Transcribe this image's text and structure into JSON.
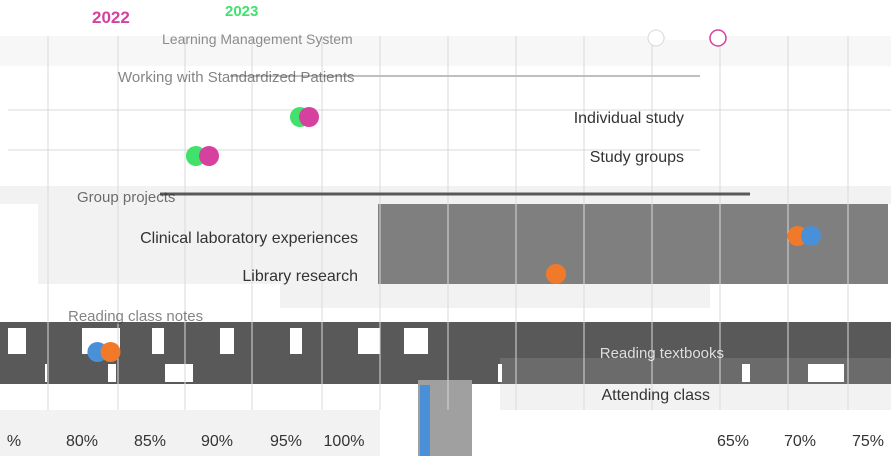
{
  "chart_data": {
    "type": "scatter",
    "legend": {
      "placement": "top-left",
      "entries": [
        {
          "name": "2022",
          "color": "#d6409f"
        },
        {
          "name": "2023",
          "color": "#41e26b"
        }
      ]
    },
    "colors": {
      "2022": "#d6409f",
      "2023": "#41e26b",
      "orange": "#f07a2a",
      "blue": "#4a90d9",
      "gray_block": "#595959",
      "light_block": "#f2f2f2",
      "mid_gray": "#7f7f7f"
    },
    "categories": [
      "Learning Management System",
      "Working with Standardized Patients",
      "Individual study",
      "Study groups",
      "Group projects",
      "Clinical laboratory experiences",
      "Library research",
      "Reading class notes",
      "Reading textbooks",
      "Attending class"
    ],
    "series_points": [
      {
        "category": "Individual study",
        "color": "#41e26b",
        "x": 0.55
      },
      {
        "category": "Individual study",
        "color": "#d6409f",
        "x": 0.56
      },
      {
        "category": "Study groups",
        "color": "#41e26b",
        "x": 0.89
      },
      {
        "category": "Study groups",
        "color": "#d6409f",
        "x": 0.9
      },
      {
        "category": "Clinical laboratory experiences",
        "color": "#f07a2a",
        "x": 0.68
      },
      {
        "category": "Clinical laboratory experiences",
        "color": "#4a90d9",
        "x": 0.69
      },
      {
        "category": "Library research",
        "color": "#f07a2a",
        "x": 0.61
      },
      {
        "category": "Reading textbooks",
        "color": "#4a90d9",
        "x": 0.84
      },
      {
        "category": "Reading textbooks",
        "color": "#f07a2a",
        "x": 0.85
      }
    ],
    "x_tick_labels_left": [
      "%",
      "80%",
      "85%",
      "90%",
      "95%",
      "100%"
    ],
    "x_tick_labels_right": [
      "65%",
      "70%",
      "75%"
    ],
    "grid": true
  }
}
